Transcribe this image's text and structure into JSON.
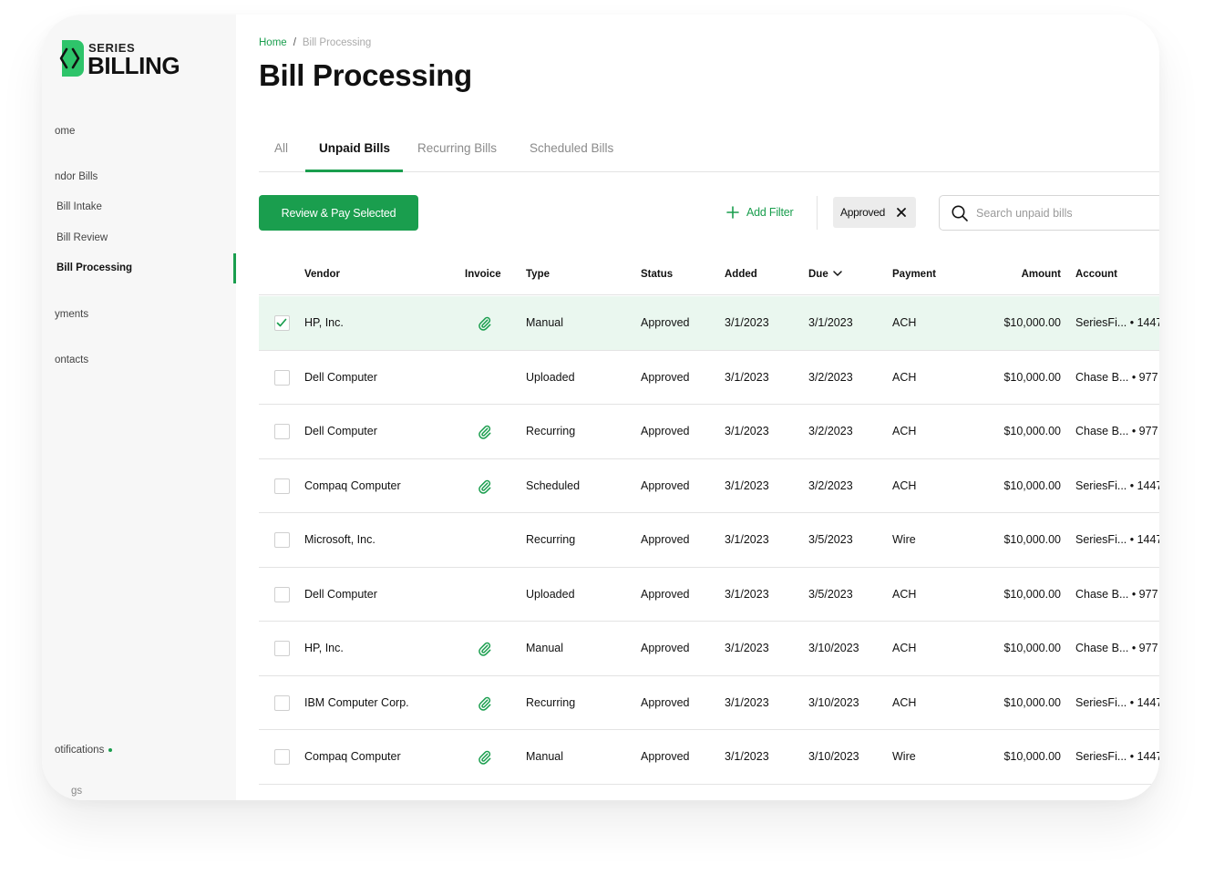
{
  "brand": {
    "series": "SERIES",
    "billing": "BILLING",
    "mark_color": "#2ec46a"
  },
  "sidebar": {
    "items": [
      {
        "label": "ome"
      },
      {
        "label": "ndor Bills"
      },
      {
        "label": "Bill Intake"
      },
      {
        "label": "Bill Review"
      },
      {
        "label": "Bill Processing"
      },
      {
        "label": "yments"
      },
      {
        "label": "ontacts"
      },
      {
        "label": "otifications"
      },
      {
        "label": "gs"
      }
    ],
    "active_index": 4
  },
  "breadcrumb": {
    "home": "Home",
    "separator": "/",
    "current": "Bill Processing"
  },
  "page_title": "Bill Processing",
  "tabs": [
    {
      "label": "All"
    },
    {
      "label": "Unpaid Bills"
    },
    {
      "label": "Recurring Bills"
    },
    {
      "label": "Scheduled Bills"
    }
  ],
  "active_tab": 1,
  "toolbar": {
    "review_pay_label": "Review & Pay Selected",
    "add_filter_label": "Add Filter",
    "filter_chip_label": "Approved",
    "search_placeholder": "Search unpaid bills",
    "search_value": ""
  },
  "table": {
    "columns": {
      "vendor": "Vendor",
      "invoice": "Invoice",
      "type": "Type",
      "status": "Status",
      "added": "Added",
      "due": "Due",
      "payment": "Payment",
      "amount": "Amount",
      "account": "Account"
    },
    "rows": [
      {
        "selected": true,
        "vendor": "HP, Inc.",
        "invoice": true,
        "type": "Manual",
        "status": "Approved",
        "added": "3/1/2023",
        "due": "3/1/2023",
        "payment": "ACH",
        "amount": "$10,000.00",
        "account": "SeriesFi... • 1447"
      },
      {
        "selected": false,
        "vendor": "Dell Computer",
        "invoice": false,
        "type": "Uploaded",
        "status": "Approved",
        "added": "3/1/2023",
        "due": "3/2/2023",
        "payment": "ACH",
        "amount": "$10,000.00",
        "account": "Chase B... • 977"
      },
      {
        "selected": false,
        "vendor": "Dell Computer",
        "invoice": true,
        "type": "Recurring",
        "status": "Approved",
        "added": "3/1/2023",
        "due": "3/2/2023",
        "payment": "ACH",
        "amount": "$10,000.00",
        "account": "Chase B... • 977"
      },
      {
        "selected": false,
        "vendor": "Compaq Computer",
        "invoice": true,
        "type": "Scheduled",
        "status": "Approved",
        "added": "3/1/2023",
        "due": "3/2/2023",
        "payment": "ACH",
        "amount": "$10,000.00",
        "account": "SeriesFi... • 1447"
      },
      {
        "selected": false,
        "vendor": "Microsoft, Inc.",
        "invoice": false,
        "type": "Recurring",
        "status": "Approved",
        "added": "3/1/2023",
        "due": "3/5/2023",
        "payment": "Wire",
        "amount": "$10,000.00",
        "account": "SeriesFi... • 1447"
      },
      {
        "selected": false,
        "vendor": "Dell Computer",
        "invoice": false,
        "type": "Uploaded",
        "status": "Approved",
        "added": "3/1/2023",
        "due": "3/5/2023",
        "payment": "ACH",
        "amount": "$10,000.00",
        "account": "Chase B... • 977"
      },
      {
        "selected": false,
        "vendor": "HP, Inc.",
        "invoice": true,
        "type": "Manual",
        "status": "Approved",
        "added": "3/1/2023",
        "due": "3/10/2023",
        "payment": "ACH",
        "amount": "$10,000.00",
        "account": "Chase B... • 977"
      },
      {
        "selected": false,
        "vendor": "IBM Computer Corp.",
        "invoice": true,
        "type": "Recurring",
        "status": "Approved",
        "added": "3/1/2023",
        "due": "3/10/2023",
        "payment": "ACH",
        "amount": "$10,000.00",
        "account": "SeriesFi... • 1447"
      },
      {
        "selected": false,
        "vendor": "Compaq Computer",
        "invoice": true,
        "type": "Manual",
        "status": "Approved",
        "added": "3/1/2023",
        "due": "3/10/2023",
        "payment": "Wire",
        "amount": "$10,000.00",
        "account": "SeriesFi... • 1447"
      }
    ]
  },
  "colors": {
    "accent": "#1a9e4e",
    "selected_row": "#eaf7ef",
    "sidebar_bg": "#f7f7f7"
  }
}
